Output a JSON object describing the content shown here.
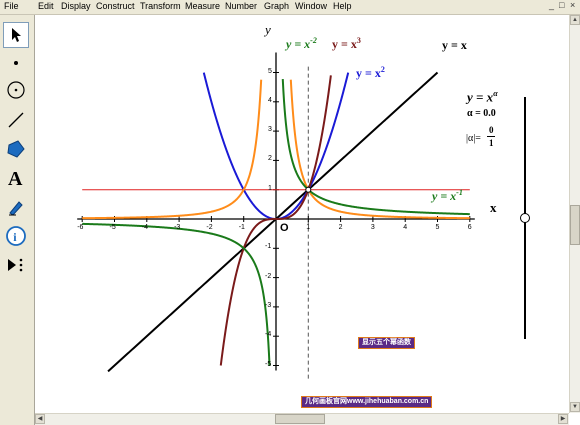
{
  "menu": [
    "File",
    "Edit",
    "Display",
    "Construct",
    "Transform",
    "Measure",
    "Number",
    "Graph",
    "Window",
    "Help"
  ],
  "window_controls": [
    "_",
    "□",
    "×"
  ],
  "colors": {
    "orange": "#ff8c1a",
    "darkgreen": "#1a7a1a",
    "darkred": "#7a1a1a",
    "blue": "#1a1ad6",
    "black": "#000000",
    "red": "#e02020"
  },
  "labels": {
    "y_axis": "y",
    "x_axis": "x",
    "origin": "O",
    "eq_x_neg2": {
      "base": "y = x",
      "exp": "-2"
    },
    "eq_x3": {
      "base": "y = x",
      "exp": "3"
    },
    "eq_x2": {
      "base": "y = x",
      "exp": "2"
    },
    "eq_x": "y = x",
    "eq_x_neg1": {
      "base": "y = x",
      "exp": "-1"
    },
    "param_formula": {
      "base": "y = x",
      "exp": "α"
    },
    "alpha_value": "α = 0.0",
    "abs_alpha": "|α|=",
    "frac_num": "0",
    "frac_den": "1"
  },
  "ticks": {
    "x": [
      "-6",
      "-5",
      "-4",
      "-3",
      "-2",
      "-1",
      "1",
      "2",
      "3",
      "4",
      "5",
      "6"
    ],
    "y": [
      "5",
      "4",
      "3",
      "2",
      "1",
      "-1",
      "-2",
      "-3",
      "-4",
      "-5"
    ]
  },
  "buttons": {
    "show_functions": "显示五个幂函数",
    "website": "几何画板官网www.jihehuaban.com.cn"
  },
  "slider": {
    "value": 0.0
  },
  "chart_data": {
    "type": "line",
    "xlim": [
      -6,
      6
    ],
    "ylim": [
      -5,
      5
    ],
    "series": [
      {
        "name": "y = x^-2",
        "exponent": -2
      },
      {
        "name": "y = x^3",
        "exponent": 3
      },
      {
        "name": "y = x^2",
        "exponent": 2
      },
      {
        "name": "y = x",
        "exponent": 1
      },
      {
        "name": "y = x^-1",
        "exponent": -1
      },
      {
        "name": "y = x^α",
        "exponent": 0
      }
    ]
  }
}
